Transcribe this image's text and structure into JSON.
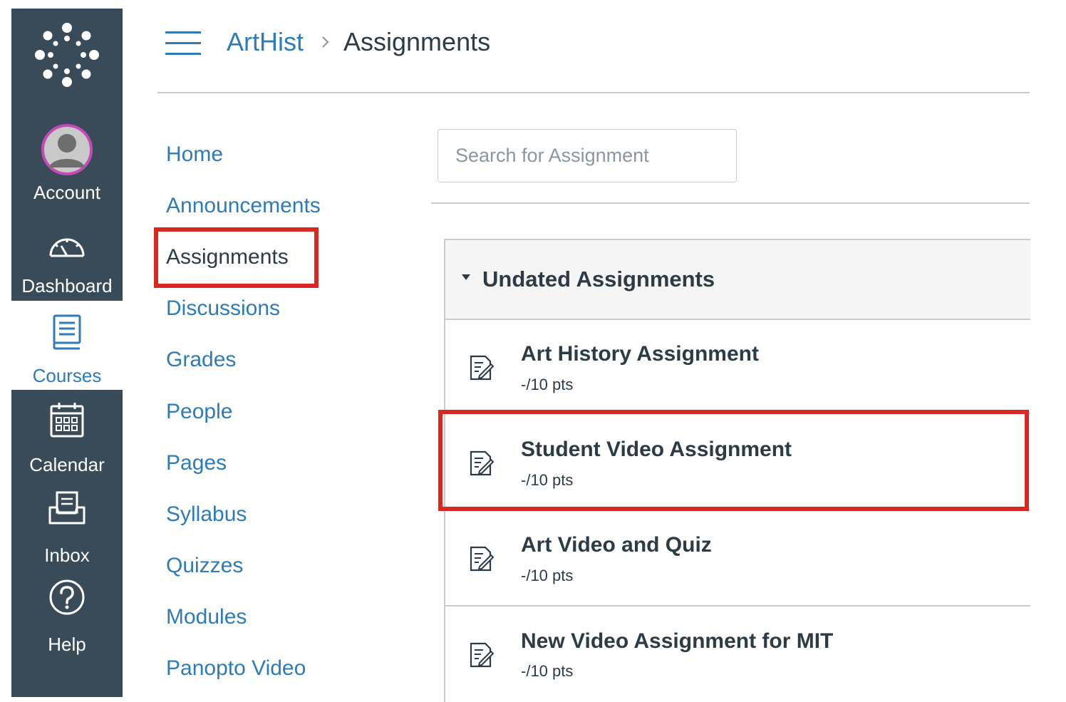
{
  "global_nav": {
    "items": [
      {
        "id": "account",
        "label": "Account",
        "icon": "avatar-icon"
      },
      {
        "id": "dashboard",
        "label": "Dashboard",
        "icon": "dashboard-icon"
      },
      {
        "id": "courses",
        "label": "Courses",
        "icon": "courses-icon",
        "active": true
      },
      {
        "id": "calendar",
        "label": "Calendar",
        "icon": "calendar-icon"
      },
      {
        "id": "inbox",
        "label": "Inbox",
        "icon": "inbox-icon"
      },
      {
        "id": "help",
        "label": "Help",
        "icon": "help-icon"
      }
    ]
  },
  "breadcrumb": {
    "course": "ArtHist",
    "separator": ">",
    "page": "Assignments"
  },
  "course_nav": {
    "items": [
      {
        "label": "Home"
      },
      {
        "label": "Announcements"
      },
      {
        "label": "Assignments",
        "active": true,
        "highlighted": true
      },
      {
        "label": "Discussions"
      },
      {
        "label": "Grades"
      },
      {
        "label": "People"
      },
      {
        "label": "Pages"
      },
      {
        "label": "Syllabus"
      },
      {
        "label": "Quizzes"
      },
      {
        "label": "Modules"
      },
      {
        "label": "Panopto Video"
      }
    ]
  },
  "search": {
    "placeholder": "Search for Assignment",
    "value": ""
  },
  "assignment_group": {
    "title": "Undated Assignments",
    "expanded": true,
    "assignments": [
      {
        "title": "Art History Assignment",
        "points": "-/10 pts",
        "icon": "assignment-icon"
      },
      {
        "title": "Student Video Assignment",
        "points": "-/10 pts",
        "icon": "assignment-icon",
        "highlighted": true
      },
      {
        "title": "Art Video and Quiz",
        "points": "-/10 pts",
        "icon": "assignment-icon"
      },
      {
        "title": "New Video Assignment for MIT",
        "points": "-/10 pts",
        "icon": "assignment-icon"
      }
    ]
  },
  "colors": {
    "nav_background": "#394b58",
    "link": "#2d7bb8",
    "text": "#2d3b45",
    "highlight": "#d9281f",
    "border": "#c7cdd1"
  }
}
